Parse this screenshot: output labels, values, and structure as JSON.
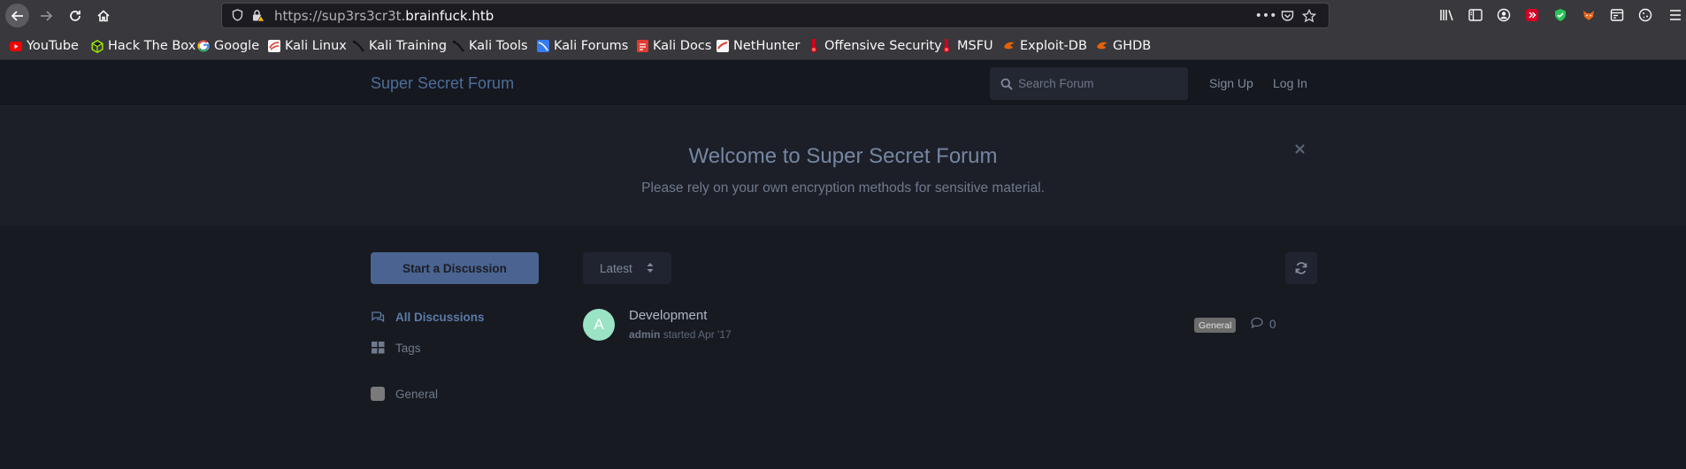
{
  "browser": {
    "url_scheme_path": "https://sup3rs3cr3t.",
    "url_host": "brainfuck.htb",
    "bookmarks": [
      {
        "label": "YouTube",
        "icon": "youtube-icon",
        "color": "#ff0000"
      },
      {
        "label": "Hack The Box",
        "icon": "hackthebox-icon",
        "color": "#9fef00"
      },
      {
        "label": "Google",
        "icon": "google-icon",
        "color": "#4285f4"
      },
      {
        "label": "Kali Linux",
        "icon": "kali-icon",
        "color": "#e03c31"
      },
      {
        "label": "Kali Training",
        "icon": "kali-dragon-icon",
        "color": "#000000"
      },
      {
        "label": "Kali Tools",
        "icon": "kali-dragon-icon",
        "color": "#000000"
      },
      {
        "label": "Kali Forums",
        "icon": "kali-forums-icon",
        "color": "#367bf0"
      },
      {
        "label": "Kali Docs",
        "icon": "kali-docs-icon",
        "color": "#e03c31"
      },
      {
        "label": "NetHunter",
        "icon": "nethunter-icon",
        "color": "#e03c31"
      },
      {
        "label": "Offensive Security",
        "icon": "offsec-icon",
        "color": "#d0021b"
      },
      {
        "label": "MSFU",
        "icon": "offsec-icon",
        "color": "#d0021b"
      },
      {
        "label": "Exploit-DB",
        "icon": "exploitdb-icon",
        "color": "#e36209"
      },
      {
        "label": "GHDB",
        "icon": "exploitdb-icon",
        "color": "#e36209"
      }
    ]
  },
  "forum": {
    "brand": "Super Secret Forum",
    "search_placeholder": "Search Forum",
    "signup": "Sign Up",
    "login": "Log In",
    "hero_title": "Welcome to Super Secret Forum",
    "hero_subtitle": "Please rely on your own encryption methods for sensitive material.",
    "start_discussion": "Start a Discussion",
    "nav": {
      "all_discussions": "All Discussions",
      "tags": "Tags",
      "general": "General"
    },
    "sort_label": "Latest",
    "discussions": [
      {
        "avatar_letter": "A",
        "title": "Development",
        "author": "admin",
        "meta": "started Apr '17",
        "tag": "General",
        "replies": "0"
      }
    ]
  },
  "colors": {
    "accent": "#4d6d99",
    "button": "#4a6391",
    "avatar": "#9be3c5"
  }
}
